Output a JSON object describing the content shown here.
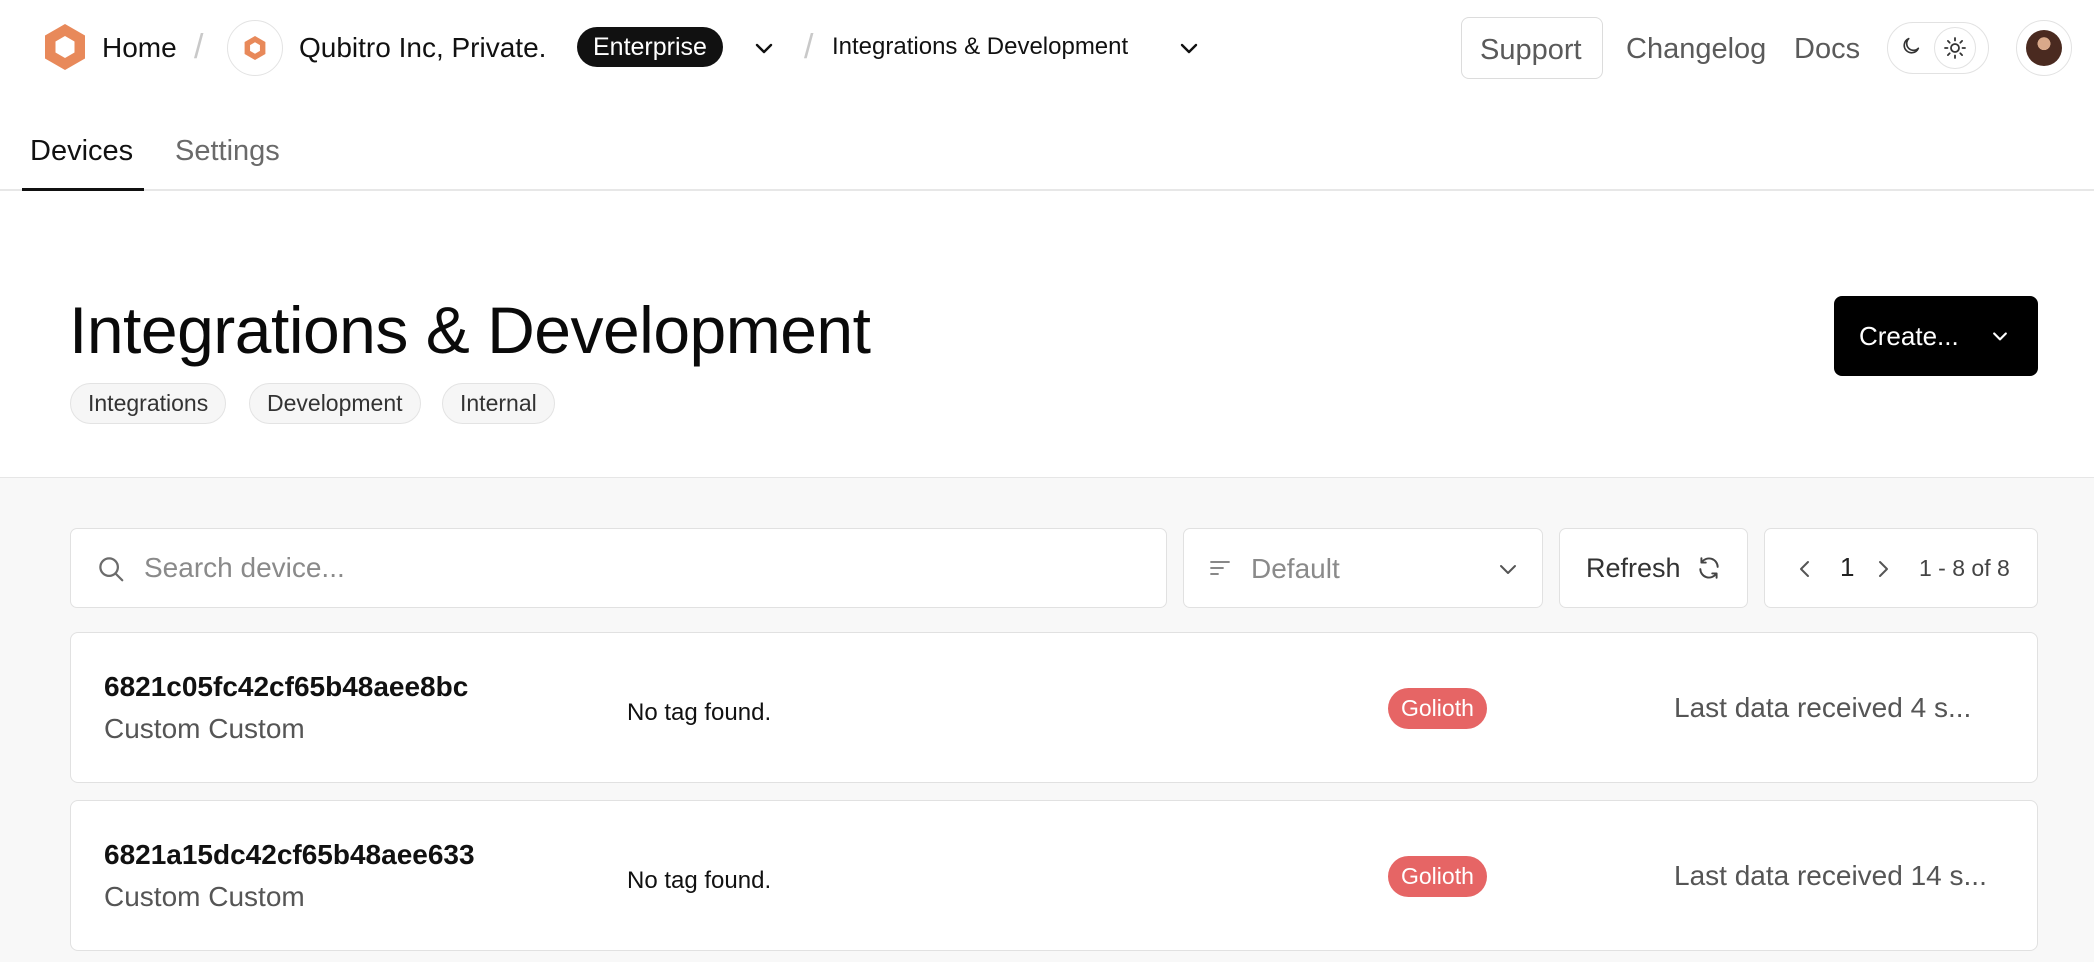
{
  "nav": {
    "home_label": "Home",
    "org_name": "Qubitro Inc, Private.",
    "plan_badge": "Enterprise",
    "project_name": "Integrations & Development",
    "support_label": "Support",
    "changelog_label": "Changelog",
    "docs_label": "Docs"
  },
  "tabs": [
    {
      "label": "Devices",
      "active": true
    },
    {
      "label": "Settings",
      "active": false
    }
  ],
  "header": {
    "title": "Integrations & Development",
    "tags": [
      "Integrations",
      "Development",
      "Internal"
    ],
    "create_label": "Create..."
  },
  "toolbar": {
    "search_placeholder": "Search device...",
    "sort_value": "Default",
    "refresh_label": "Refresh",
    "page": "1",
    "range": "1 - 8 of 8"
  },
  "devices": [
    {
      "id": "6821c05fc42cf65b48aee8bc",
      "type": "Custom Custom",
      "tags": "No tag found.",
      "integration": "Golioth",
      "last_data": "Last data received 4 s..."
    },
    {
      "id": "6821a15dc42cf65b48aee633",
      "type": "Custom Custom",
      "tags": "No tag found.",
      "integration": "Golioth",
      "last_data": "Last data received 14 s..."
    }
  ],
  "colors": {
    "brand_orange": "#e8895a",
    "golioth_red": "#e66565",
    "primary_black": "#000000"
  },
  "icons": {
    "logo": "hexagon-logo-icon",
    "org": "hexagon-org-icon",
    "theme_dark": "moon-icon",
    "theme_light": "sun-icon",
    "search": "search-icon",
    "sort": "sort-lines-icon",
    "refresh": "refresh-icon"
  }
}
